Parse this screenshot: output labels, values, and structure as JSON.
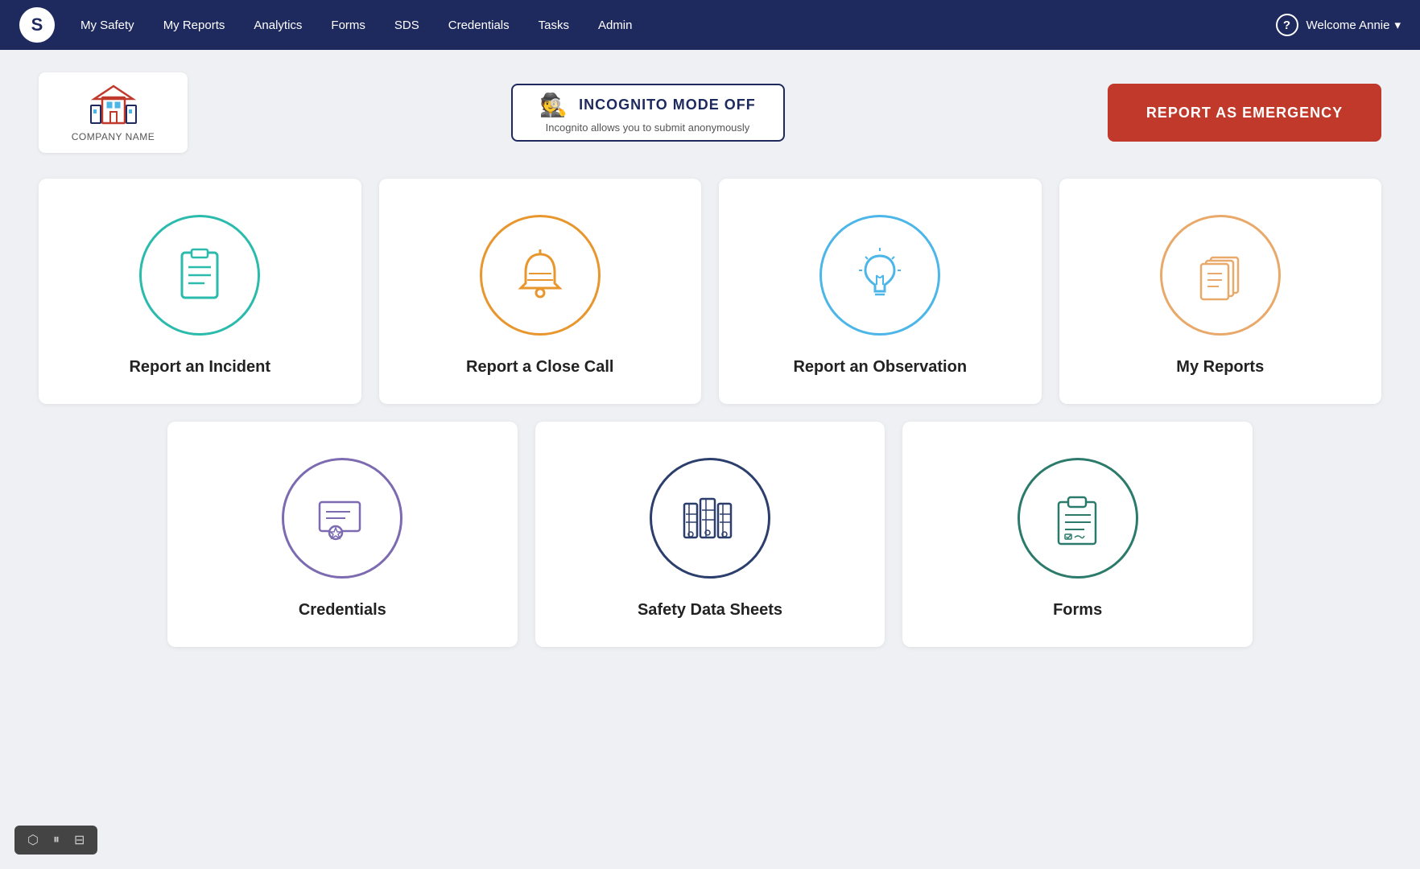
{
  "navbar": {
    "logo_letter": "S",
    "items": [
      {
        "label": "My Safety",
        "id": "my-safety"
      },
      {
        "label": "My Reports",
        "id": "my-reports"
      },
      {
        "label": "Analytics",
        "id": "analytics"
      },
      {
        "label": "Forms",
        "id": "forms"
      },
      {
        "label": "SDS",
        "id": "sds"
      },
      {
        "label": "Credentials",
        "id": "credentials"
      },
      {
        "label": "Tasks",
        "id": "tasks"
      },
      {
        "label": "Admin",
        "id": "admin"
      }
    ],
    "help_label": "?",
    "welcome_text": "Welcome Annie",
    "chevron": "▾"
  },
  "company": {
    "name": "COMPANY NAME"
  },
  "incognito": {
    "label": "INCOGNITO MODE OFF",
    "sub": "Incognito allows you to submit anonymously"
  },
  "emergency": {
    "label": "REPORT AS EMERGENCY"
  },
  "cards_top": [
    {
      "id": "report-incident",
      "label": "Report an Incident",
      "color": "teal"
    },
    {
      "id": "report-close-call",
      "label": "Report a Close Call",
      "color": "orange"
    },
    {
      "id": "report-observation",
      "label": "Report an Observation",
      "color": "blue"
    },
    {
      "id": "my-reports",
      "label": "My Reports",
      "color": "light-orange"
    }
  ],
  "cards_bottom": [
    {
      "id": "credentials",
      "label": "Credentials",
      "color": "purple"
    },
    {
      "id": "safety-data-sheets",
      "label": "Safety Data Sheets",
      "color": "dark-navy"
    },
    {
      "id": "forms",
      "label": "Forms",
      "color": "dark-teal"
    }
  ],
  "bottom_bar": {
    "btn1": "⬡",
    "btn2": "⏸",
    "btn3": "⊟"
  }
}
